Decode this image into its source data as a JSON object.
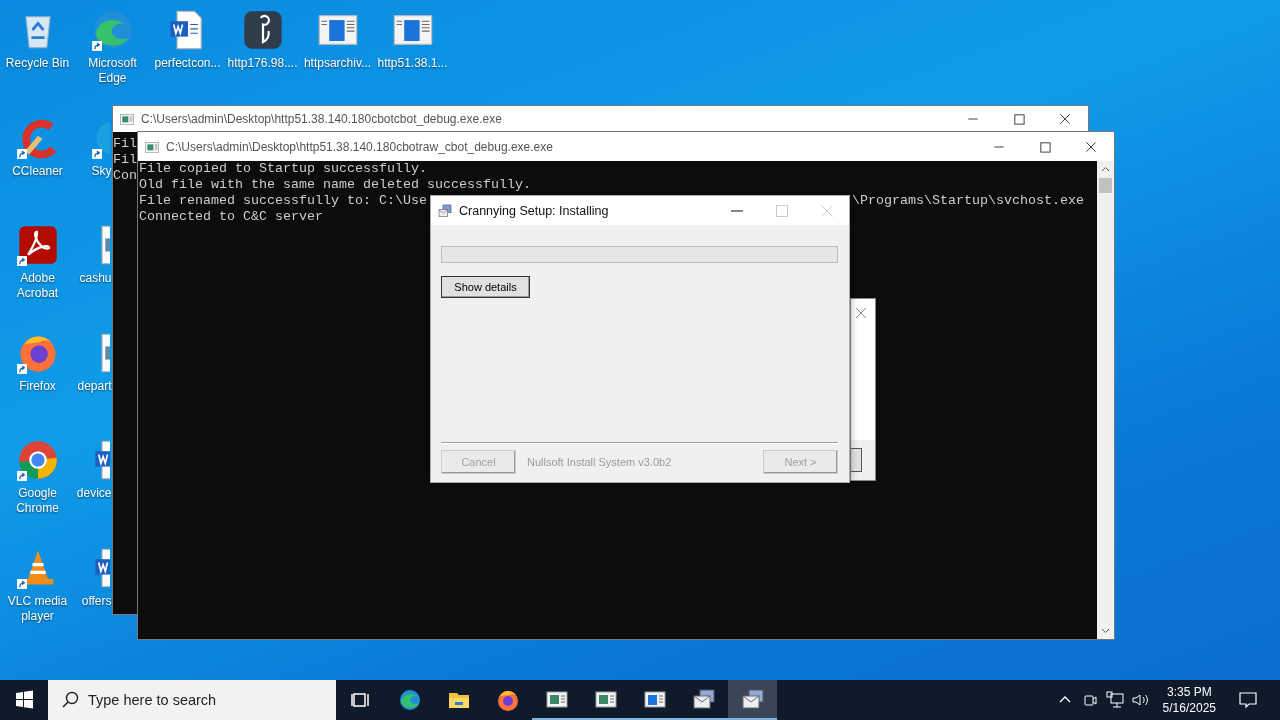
{
  "desktop": {
    "icon_columns": [
      [
        {
          "label": "Recycle Bin",
          "shortcut": false
        },
        {
          "label": "CCleaner",
          "shortcut": true
        },
        {
          "label": "Adobe Acrobat",
          "shortcut": true
        },
        {
          "label": "Firefox",
          "shortcut": true
        },
        {
          "label": "Google Chrome",
          "shortcut": true
        },
        {
          "label": "VLC media player",
          "shortcut": true
        }
      ],
      [
        {
          "label": "Microsoft Edge",
          "shortcut": true
        },
        {
          "label": "Sky",
          "shortcut": true
        },
        {
          "label": "cashu",
          "shortcut": false
        },
        {
          "label": "depart",
          "shortcut": false
        },
        {
          "label": "device",
          "shortcut": false
        },
        {
          "label": "offers",
          "shortcut": false
        }
      ],
      [
        {
          "label": "perfectcon...",
          "shortcut": false
        }
      ],
      [
        {
          "label": "http176.98....",
          "shortcut": false
        }
      ],
      [
        {
          "label": "httpsarchiv...",
          "shortcut": false
        }
      ],
      [
        {
          "label": "http51.38.1...",
          "shortcut": false
        }
      ]
    ]
  },
  "back_console": {
    "title": "C:\\Users\\admin\\Desktop\\http51.38.140.180cbotcbot_debug.exe.exe",
    "lines": [
      "Fil",
      "Fil",
      "Con"
    ]
  },
  "front_console": {
    "title": "C:\\Users\\admin\\Desktop\\http51.38.140.180cbotraw_cbot_debug.exe.exe",
    "lines": [
      {
        "text": "File copied to Startup successfully."
      },
      {
        "text": "Old file with the same name deleted successfully."
      },
      {
        "text": "File renamed successfully to: C:\\Use",
        "tail": "\\Programs\\Startup\\svchost.exe"
      },
      {
        "text": "Connected to C&C server"
      }
    ]
  },
  "installer": {
    "title": "Crannying Setup: Installing",
    "progress": {
      "level": 0
    },
    "details_button": {
      "label": "Show details",
      "disabled": false
    },
    "branding": "Nullsoft Install System v3.0b2",
    "buttons": [
      {
        "label": "Cancel",
        "disabled": true
      },
      {
        "label": "Next >",
        "disabled": true
      }
    ]
  },
  "taskbar": {
    "search": {
      "placeholder": "Type here to search"
    },
    "apps": [
      {
        "running": false,
        "selected": false
      },
      {
        "running": false,
        "selected": false
      },
      {
        "running": false,
        "selected": false
      },
      {
        "running": false,
        "selected": false
      },
      {
        "running": true,
        "selected": false
      },
      {
        "running": true,
        "selected": false
      },
      {
        "running": true,
        "selected": false
      },
      {
        "running": true,
        "selected": false
      },
      {
        "running": true,
        "selected": true
      }
    ],
    "time": "3:35 PM",
    "date": "5/16/2025"
  }
}
